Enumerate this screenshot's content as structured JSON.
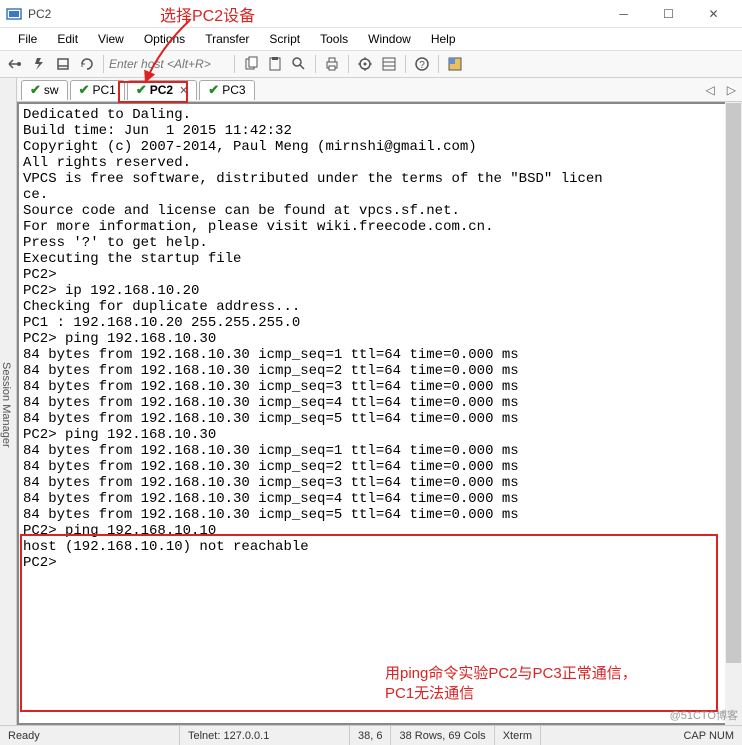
{
  "window": {
    "title": "PC2"
  },
  "menu": [
    "File",
    "Edit",
    "View",
    "Options",
    "Transfer",
    "Script",
    "Tools",
    "Window",
    "Help"
  ],
  "host_input": {
    "placeholder": "Enter host <Alt+R>"
  },
  "sidebar": {
    "label": "Session Manager"
  },
  "tabs": [
    {
      "label": "sw"
    },
    {
      "label": "PC1"
    },
    {
      "label": "PC2",
      "active": true
    },
    {
      "label": "PC3"
    }
  ],
  "tab_nav": {
    "left": "◁",
    "right": "▷"
  },
  "terminal_lines": [
    "Dedicated to Daling.",
    "Build time: Jun  1 2015 11:42:32",
    "Copyright (c) 2007-2014, Paul Meng (mirnshi@gmail.com)",
    "All rights reserved.",
    "",
    "VPCS is free software, distributed under the terms of the \"BSD\" licen",
    "ce.",
    "Source code and license can be found at vpcs.sf.net.",
    "For more information, please visit wiki.freecode.com.cn.",
    "",
    "Press '?' to get help.",
    "",
    "Executing the startup file",
    "",
    "",
    "PC2>",
    "PC2> ip 192.168.10.20",
    "Checking for duplicate address...",
    "PC1 : 192.168.10.20 255.255.255.0",
    "",
    "PC2> ping 192.168.10.30",
    "84 bytes from 192.168.10.30 icmp_seq=1 ttl=64 time=0.000 ms",
    "84 bytes from 192.168.10.30 icmp_seq=2 ttl=64 time=0.000 ms",
    "84 bytes from 192.168.10.30 icmp_seq=3 ttl=64 time=0.000 ms",
    "84 bytes from 192.168.10.30 icmp_seq=4 ttl=64 time=0.000 ms",
    "84 bytes from 192.168.10.30 icmp_seq=5 ttl=64 time=0.000 ms",
    "",
    "PC2> ping 192.168.10.30",
    "84 bytes from 192.168.10.30 icmp_seq=1 ttl=64 time=0.000 ms",
    "84 bytes from 192.168.10.30 icmp_seq=2 ttl=64 time=0.000 ms",
    "84 bytes from 192.168.10.30 icmp_seq=3 ttl=64 time=0.000 ms",
    "84 bytes from 192.168.10.30 icmp_seq=4 ttl=64 time=0.000 ms",
    "84 bytes from 192.168.10.30 icmp_seq=5 ttl=64 time=0.000 ms",
    "",
    "PC2> ping 192.168.10.10",
    "host (192.168.10.10) not reachable",
    "",
    "PC2>"
  ],
  "status": {
    "ready": "Ready",
    "telnet": "Telnet: 127.0.0.1",
    "cursor": "38,   6",
    "size": "38 Rows, 69 Cols",
    "emu": "Xterm",
    "cap": "CAP  NUM"
  },
  "annotations": {
    "top": "选择PC2设备",
    "bottom1": "用ping命令实验PC2与PC3正常通信，",
    "bottom2": "PC1无法通信"
  },
  "watermark": "@51CTO博客"
}
